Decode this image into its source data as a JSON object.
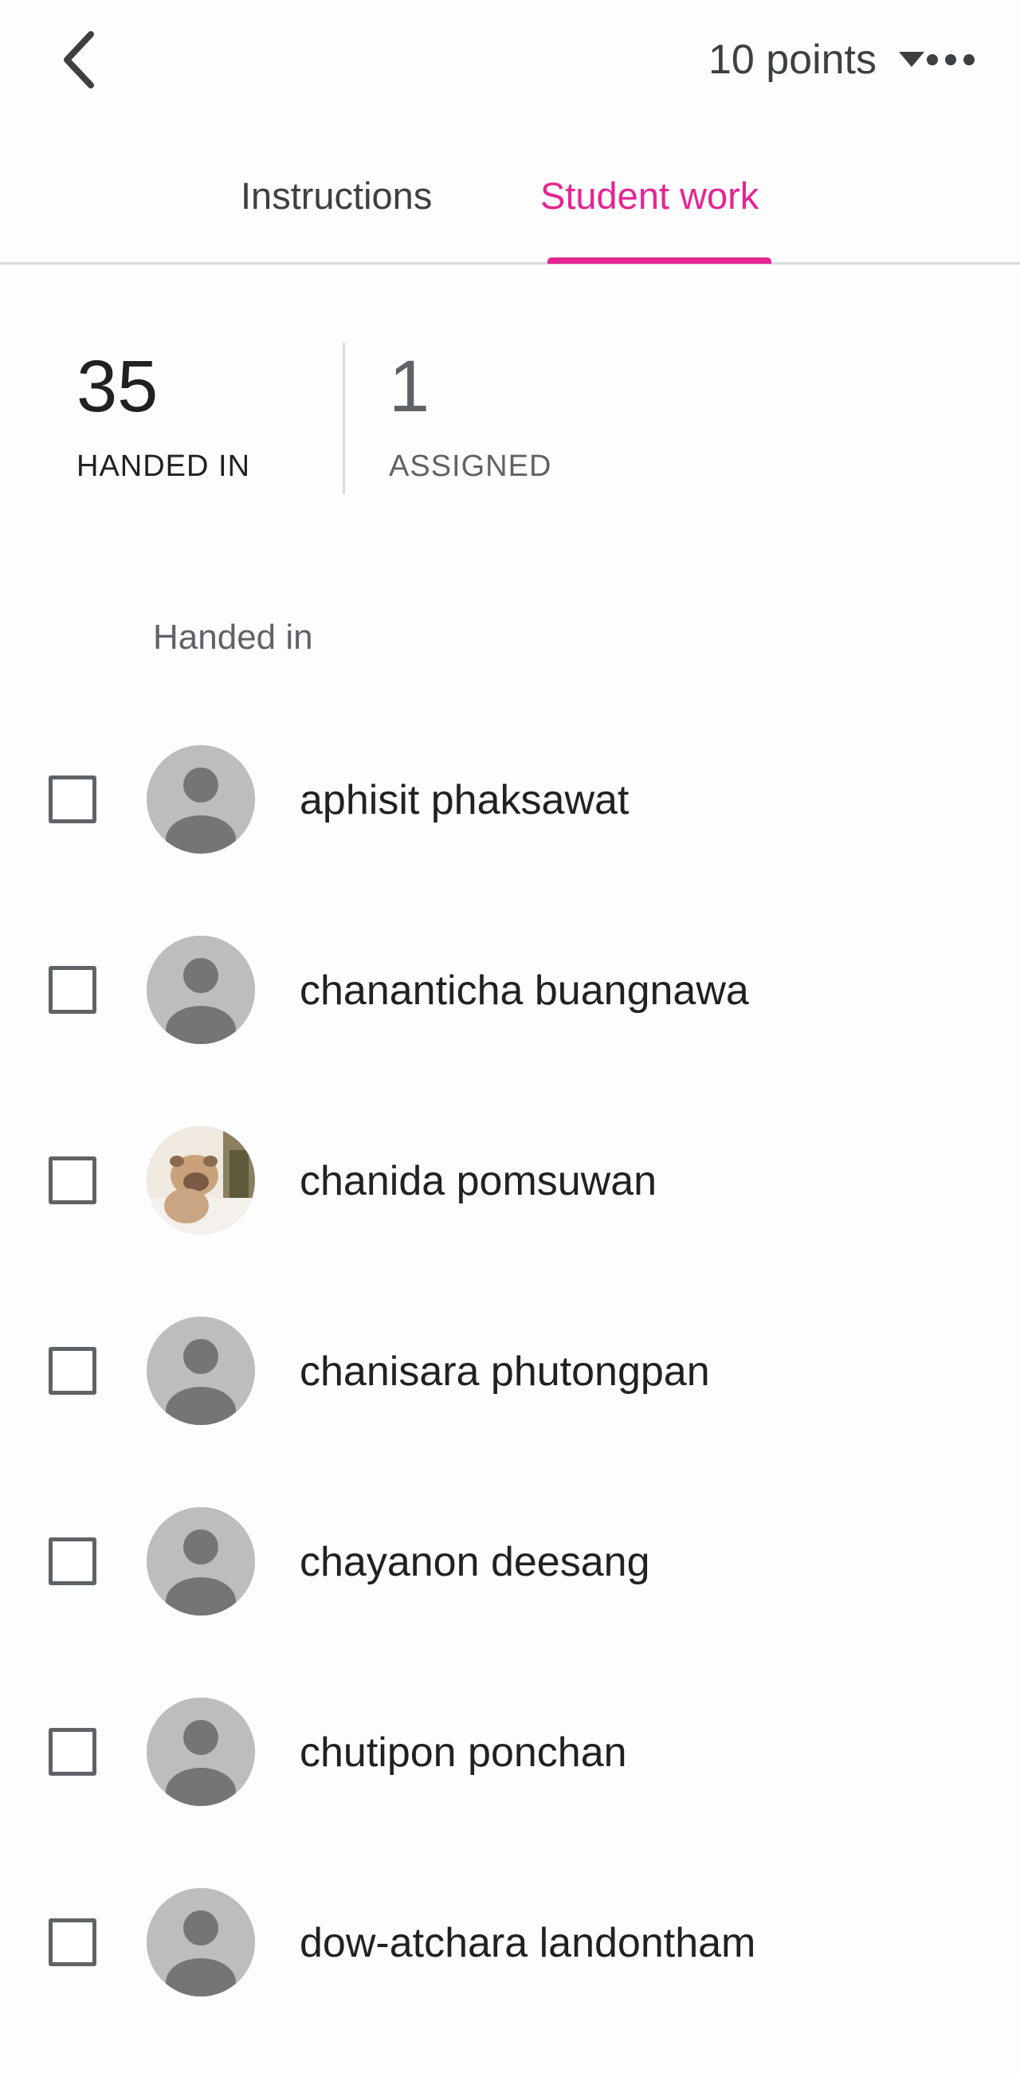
{
  "header": {
    "points_label": "10 points"
  },
  "tabs": [
    {
      "label": "Instructions",
      "active": false
    },
    {
      "label": "Student work",
      "active": true
    }
  ],
  "colors": {
    "accent": "#e52592",
    "avatar_placeholder": "#bdbdbd"
  },
  "stats": {
    "handed_in": {
      "count": "35",
      "label": "HANDED IN"
    },
    "assigned": {
      "count": "1",
      "label": "ASSIGNED"
    }
  },
  "section": {
    "title": "Handed in"
  },
  "students": [
    {
      "name": "aphisit phaksawat",
      "avatar": "default-avatar-icon"
    },
    {
      "name": "chananticha buangnawa",
      "avatar": "default-avatar-icon"
    },
    {
      "name": "chanida pomsuwan",
      "avatar": "photo"
    },
    {
      "name": "chanisara phutongpan",
      "avatar": "default-avatar-icon"
    },
    {
      "name": "chayanon deesang",
      "avatar": "default-avatar-icon"
    },
    {
      "name": "chutipon ponchan",
      "avatar": "default-avatar-icon"
    },
    {
      "name": "dow-atchara landontham",
      "avatar": "default-avatar-icon"
    }
  ]
}
